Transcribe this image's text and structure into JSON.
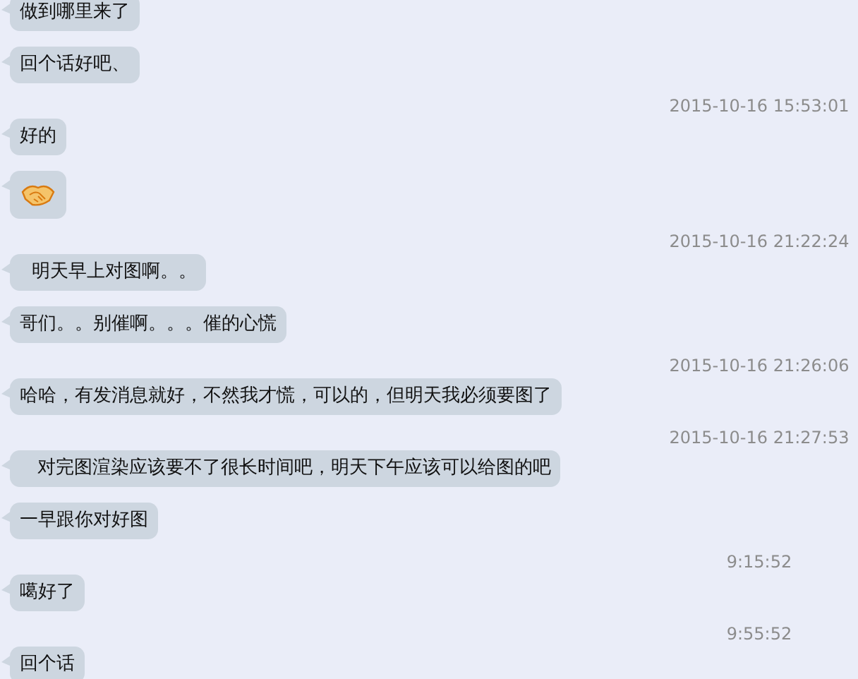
{
  "messages": [
    {
      "kind": "text",
      "text": "做到哪里来了"
    },
    {
      "kind": "text",
      "text": "回个话好吧、"
    },
    {
      "kind": "time",
      "text": "2015-10-16 15:53:01"
    },
    {
      "kind": "text",
      "text": "好的"
    },
    {
      "kind": "emoji"
    },
    {
      "kind": "time",
      "text": "2015-10-16 21:22:24"
    },
    {
      "kind": "text",
      "text": "  明天早上对图啊。。"
    },
    {
      "kind": "text",
      "text": "哥们。。别催啊。。。催的心慌"
    },
    {
      "kind": "time",
      "text": "2015-10-16 21:26:06"
    },
    {
      "kind": "text",
      "text": "哈哈，有发消息就好，不然我才慌，可以的，但明天我必须要图了"
    },
    {
      "kind": "time",
      "text": "2015-10-16 21:27:53"
    },
    {
      "kind": "text",
      "text": "   对完图渲染应该要不了很长时间吧，明天下午应该可以给图的吧"
    },
    {
      "kind": "text",
      "text": "一早跟你对好图"
    },
    {
      "kind": "time",
      "text": "9:15:52"
    },
    {
      "kind": "text",
      "text": "噶好了"
    },
    {
      "kind": "time",
      "text": "9:55:52"
    },
    {
      "kind": "text",
      "text": "回个话"
    }
  ]
}
